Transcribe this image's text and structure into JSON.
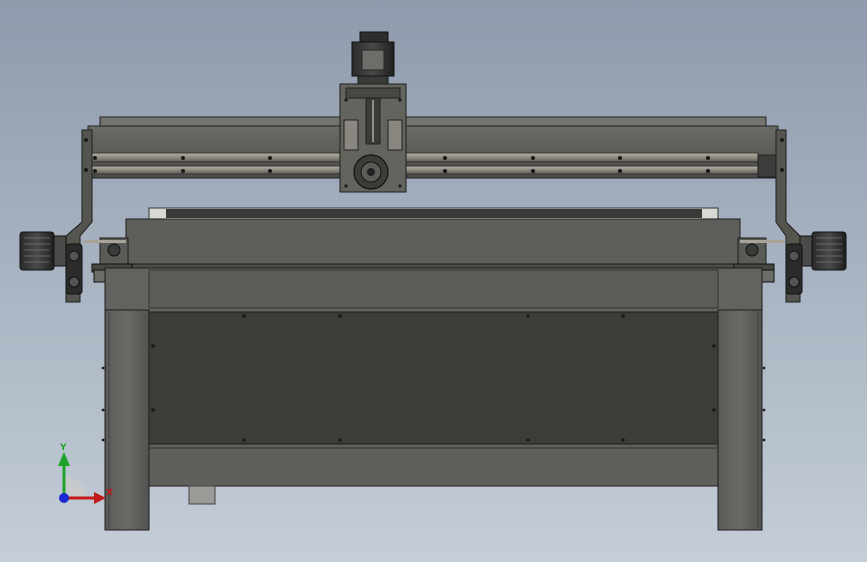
{
  "viewport": {
    "background_top": "#8e9bac",
    "background_bottom": "#c4cdd8"
  },
  "triad": {
    "y_label": "Y",
    "x_label": "X",
    "y_color": "#1fa32a",
    "x_color": "#c21a1a",
    "z_color": "#1b2ad0"
  }
}
